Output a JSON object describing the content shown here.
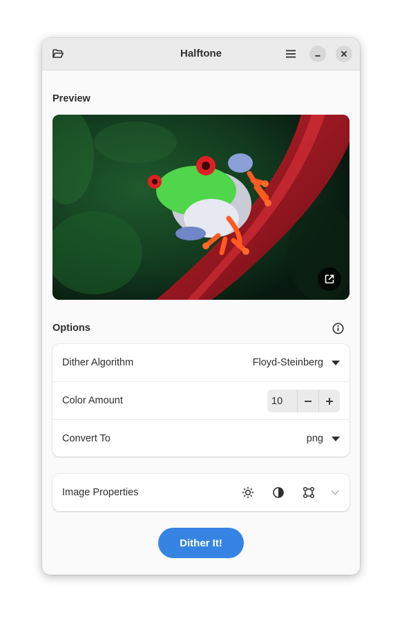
{
  "window": {
    "title": "Halftone"
  },
  "headerbar": {
    "open_icon": "folder-open-icon",
    "menu_icon": "hamburger-menu-icon",
    "minimize_icon": "minimize-icon",
    "close_icon": "close-icon"
  },
  "preview": {
    "label": "Preview",
    "image_subject": "red-eyed tree frog on a red stem",
    "open_external_icon": "open-external-icon"
  },
  "options": {
    "label": "Options",
    "info_icon": "info-icon",
    "rows": [
      {
        "label": "Dither Algorithm",
        "value": "Floyd-Steinberg",
        "control": "dropdown"
      },
      {
        "label": "Color Amount",
        "value": "10",
        "control": "spinbutton"
      },
      {
        "label": "Convert To",
        "value": "png",
        "control": "dropdown"
      }
    ]
  },
  "image_properties": {
    "label": "Image Properties",
    "icons": [
      "brightness-icon",
      "contrast-icon",
      "transform-icon",
      "chevron-down-icon"
    ]
  },
  "actions": {
    "dither_label": "Dither It!"
  },
  "colors": {
    "accent": "#3584e4",
    "headerbar": "#ebebeb",
    "window_bg": "#fafafa"
  }
}
